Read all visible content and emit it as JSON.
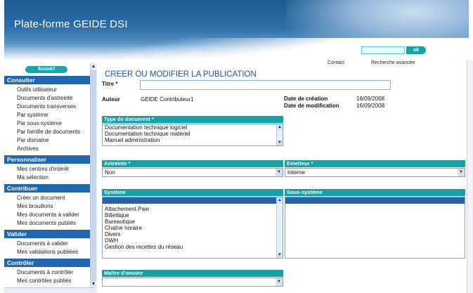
{
  "header": {
    "brand": "Plate-forme GEIDE DSI",
    "search_button": "ok",
    "links": [
      "Contact",
      "Recherche avancée"
    ]
  },
  "sidebar": {
    "home": "Accueil",
    "sections": [
      {
        "title": "Consulter",
        "items": [
          "Outils utilisateur",
          "Documents d'astreinte",
          "Documents transverses",
          "Par système",
          "Par sous-système",
          "Par famille de documents",
          "Par domaine",
          "Archives"
        ]
      },
      {
        "title": "Personnaliser",
        "items": [
          "Mes centres d'intérêt",
          "Ma sélection"
        ]
      },
      {
        "title": "Contribuer",
        "items": [
          "Créer un document",
          "Mes brouillons",
          "Mes documents à valider",
          "Mes documents publiés"
        ]
      },
      {
        "title": "Valider",
        "items": [
          "Documents à valider",
          "Mes validations publiées"
        ]
      },
      {
        "title": "Contrôler",
        "items": [
          "Documents à contrôler",
          "Mes contrôles publiés"
        ]
      }
    ]
  },
  "form": {
    "title": "CREER OU MODIFIER LA PUBLICATION",
    "titre_label": "Titre *",
    "titre_value": "",
    "auteur_label": "Auteur",
    "auteur_value": "GEIDE Contributeur1",
    "creation_label": "Date de création",
    "creation_value": "16/09/2008",
    "modif_label": "Date de modification",
    "modif_value": "16/09/2008",
    "type_label": "Type de document *",
    "type_options": [
      "Documentation technique logiciel",
      "Documentation technique matériel",
      "Manuel administration"
    ],
    "astreinte_label": "Astreinte *",
    "astreinte_value": "Non",
    "emetteur_label": "Emetteur *",
    "emetteur_value": "Interne",
    "systeme_label": "Système",
    "systeme_options": [
      "",
      "Attachement Paie",
      "Billettique",
      "Bureautique",
      "Chaîne horaire",
      "Divers",
      "DWH",
      "Gestion des recettes du réseau"
    ],
    "soussysteme_label": "Sous-système",
    "maitre_label": "Maître d'oeuvre",
    "maitre_value": ""
  }
}
